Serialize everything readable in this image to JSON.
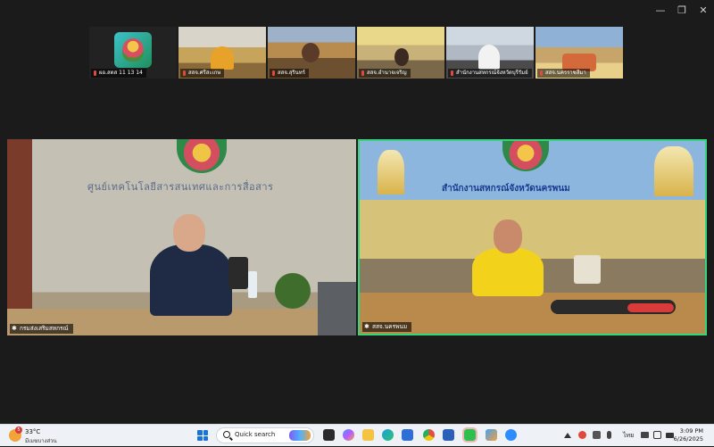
{
  "window": {
    "controls": {
      "minimize": "—",
      "restore": "❐",
      "close": "✕"
    }
  },
  "participants_strip": [
    {
      "name": "ผอ.สตส 11 13 14",
      "kind": "avatar"
    },
    {
      "name": "สสจ.ศรีสะเกษ",
      "kind": "video"
    },
    {
      "name": "สสจ.สุรินทร์",
      "kind": "video"
    },
    {
      "name": "สสจ.อำนาจเจริญ",
      "kind": "video"
    },
    {
      "name": "สำนักงานสหกรณ์จังหวัดบุรีรัมย์",
      "kind": "video"
    },
    {
      "name": "สสจ.นครราชสีมา",
      "kind": "video"
    }
  ],
  "main_tiles": [
    {
      "name": "กรมส่งเสริมสหกรณ์",
      "wall_sign": "ศูนย์เทคโนโลยีสารสนเทศและการสื่อสาร",
      "speaking": false
    },
    {
      "name": "สสจ.นครพนม",
      "backdrop_sign": "สำนักงานสหกรณ์จังหวัดนครพนม",
      "speaking": true
    }
  ],
  "taskbar": {
    "weather": {
      "temp": "33°C",
      "condition": "มีเมฆบางส่วน",
      "badge": "5"
    },
    "search_label": "Quick search",
    "apps": [
      "file-explorer-icon",
      "copilot-icon",
      "folder-icon",
      "edge-icon",
      "store-icon",
      "chrome-icon",
      "word-icon",
      "line-icon",
      "photos-icon",
      "zoom-icon"
    ],
    "tray": {
      "language": "ไทย"
    },
    "clock": {
      "time": "3:09 PM",
      "date": "6/26/2025"
    }
  },
  "colors": {
    "active_speaker_border": "#33d67a",
    "window_bg": "#1b1b1b",
    "taskbar_bg": "#eef1f5"
  }
}
